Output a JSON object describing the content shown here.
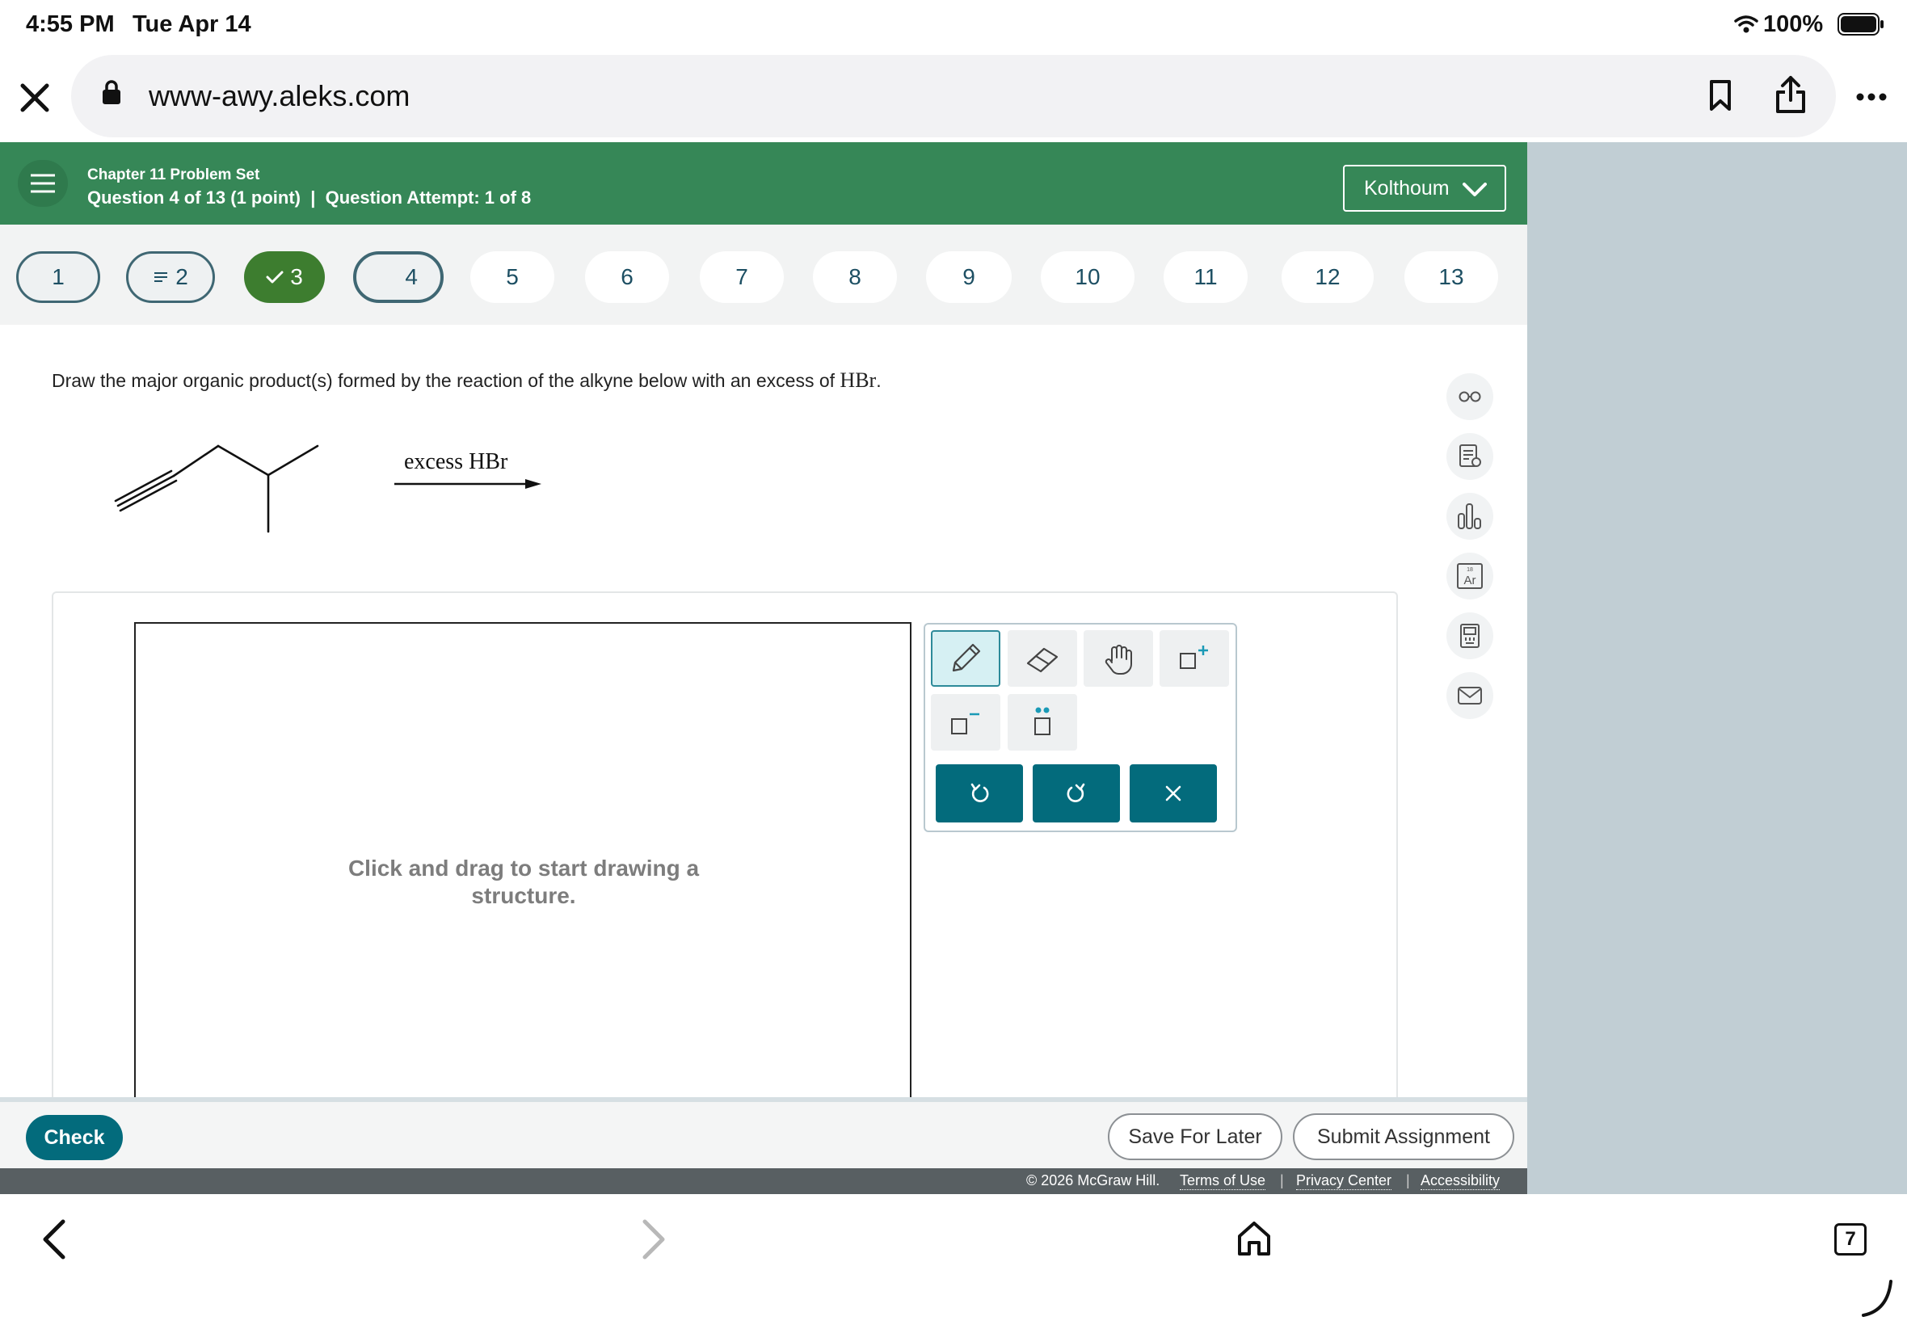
{
  "status_bar": {
    "time": "4:55 PM",
    "date": "Tue Apr 14",
    "battery": "100%",
    "icons": [
      "wifi-icon",
      "battery-icon"
    ]
  },
  "browser": {
    "url": "www-awy.aleks.com",
    "icons": [
      "close-icon",
      "lock-icon",
      "bookmark-icon",
      "share-icon",
      "more-icon"
    ]
  },
  "header": {
    "set_title": "Chapter 11 Problem Set",
    "question_info": "Question 4 of 13 (1 point)  |  Question Attempt: 1 of 8",
    "user_name": "Kolthoum",
    "brand_color": "#368757"
  },
  "question_nav": {
    "items": [
      {
        "label": "1",
        "state": "outlined"
      },
      {
        "label": "2",
        "state": "outlined-partial"
      },
      {
        "label": "3",
        "state": "done"
      },
      {
        "label": "4",
        "state": "current"
      },
      {
        "label": "5",
        "state": "plain"
      },
      {
        "label": "6",
        "state": "plain"
      },
      {
        "label": "7",
        "state": "plain"
      },
      {
        "label": "8",
        "state": "plain"
      },
      {
        "label": "9",
        "state": "plain"
      },
      {
        "label": "10",
        "state": "plain"
      },
      {
        "label": "11",
        "state": "plain"
      },
      {
        "label": "12",
        "state": "plain"
      },
      {
        "label": "13",
        "state": "plain"
      }
    ]
  },
  "question": {
    "text_before": "Draw the major organic product(s) formed by the reaction of the alkyne below with an excess of ",
    "reagent_inline": "HBr",
    "text_after": ".",
    "arrow_label": "excess HBr"
  },
  "drawing": {
    "hint": "Click and drag to start drawing a structure.",
    "tools": [
      "pencil-icon",
      "eraser-icon",
      "hand-icon",
      "add-charge-icon",
      "remove-charge-icon",
      "lone-pair-icon"
    ],
    "actions": [
      "undo-icon",
      "redo-icon",
      "clear-icon"
    ],
    "action_color": "#036b7c"
  },
  "side_tools": [
    "glasses-icon",
    "notes-icon",
    "chart-icon",
    "periodic-table-icon",
    "calculator-icon",
    "mail-icon"
  ],
  "buttons": {
    "check": "Check",
    "save_for_later": "Save For Later",
    "submit": "Submit Assignment"
  },
  "footer": {
    "copyright": "© 2026 McGraw Hill.",
    "terms": "Terms of Use",
    "privacy": "Privacy Center",
    "accessibility": "Accessibility"
  },
  "bottom_toolbar": {
    "tab_count": "7",
    "icons": [
      "back-icon",
      "forward-icon",
      "home-icon",
      "tabs-icon"
    ]
  }
}
